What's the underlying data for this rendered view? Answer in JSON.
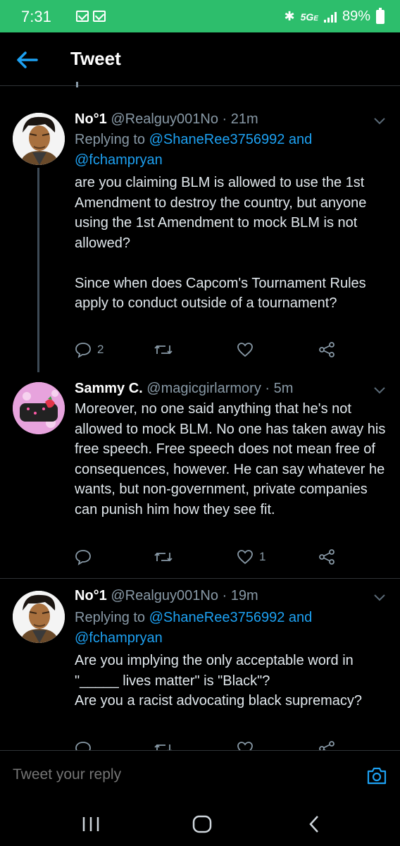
{
  "status_bar": {
    "time": "7:31",
    "network": "5G",
    "network_suffix": "E",
    "battery": "89%"
  },
  "header": {
    "title": "Tweet",
    "back_icon": "back-arrow-icon"
  },
  "tweets": [
    {
      "name": "No°1",
      "handle": "@Realguy001No",
      "time": "· 21m",
      "replying_prefix": "Replying to",
      "replying_user1": "@ShaneRee3756992",
      "replying_and": "and",
      "replying_user2": "@fchampryan",
      "body": "are you claiming BLM is allowed to use the 1st Amendment to destroy the country, but anyone using the 1st Amendment to mock BLM is not allowed?\n\nSince when does Capcom's Tournament Rules apply to conduct outside of a tournament?",
      "reply_count": "2",
      "retweet_count": "",
      "like_count": ""
    },
    {
      "name": "Sammy C.",
      "handle": "@magicgirlarmory",
      "time": "· 5m",
      "body": "Moreover, no one said anything that he's not allowed to mock BLM. No one has taken away his free speech. Free speech does not mean free of consequences, however. He can say whatever he wants, but non-government, private companies can punish him how they see fit.",
      "reply_count": "",
      "retweet_count": "",
      "like_count": "1"
    },
    {
      "name": "No°1",
      "handle": "@Realguy001No",
      "time": "· 19m",
      "replying_prefix": "Replying to",
      "replying_user1": "@ShaneRee3756992",
      "replying_and": "and",
      "replying_user2": "@fchampryan",
      "body": "Are you implying the only acceptable word in \"_____ lives matter\" is \"Black\"?\nAre you a racist advocating black supremacy?"
    }
  ],
  "reply_bar": {
    "placeholder": "Tweet your reply",
    "camera_icon": "camera-icon"
  },
  "nav_bar": {
    "recent_icon": "recent-apps-icon",
    "home_icon": "home-icon",
    "back_icon": "back-icon"
  },
  "colors": {
    "status_bar": "#2dbe6c",
    "accent": "#1da1f2",
    "background": "#000000",
    "secondary_text": "#8899a6"
  }
}
